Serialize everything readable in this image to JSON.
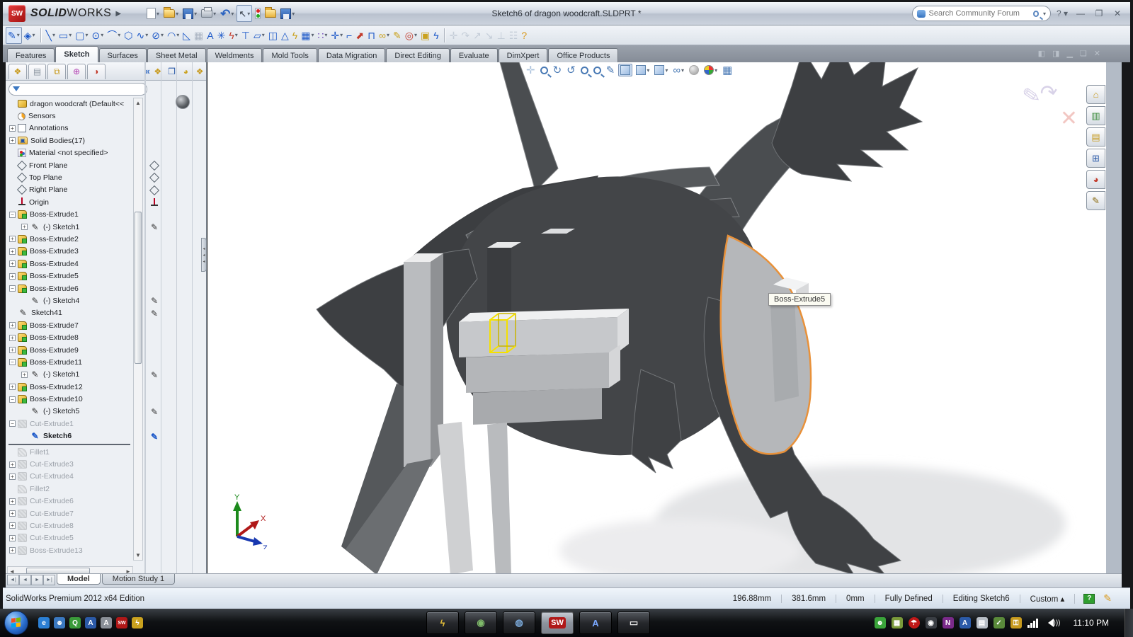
{
  "window": {
    "brand_solid": "SOLID",
    "brand_works": "WORKS",
    "title": "Sketch6 of dragon woodcraft.SLDPRT *",
    "search_placeholder": "Search Community Forum",
    "help_glyph": "?",
    "minimize_glyph": "—",
    "restore_glyph": "❐",
    "close_glyph": "✕"
  },
  "standard_toolbar": [
    {
      "name": "new-document-icon",
      "kind": "page",
      "dd": true
    },
    {
      "name": "open-icon",
      "kind": "folder",
      "dd": true
    },
    {
      "name": "save-icon",
      "kind": "save",
      "dd": true
    },
    {
      "name": "print-icon",
      "kind": "print",
      "dd": true
    },
    {
      "name": "undo-icon",
      "kind": "undo",
      "glyph": "↶",
      "dd": true
    },
    {
      "name": "select-icon",
      "kind": "cursor",
      "glyph": "↖",
      "dd": true,
      "pressed": true
    },
    {
      "name": "rebuild-traffic-icon",
      "kind": "traffic",
      "dd": false
    },
    {
      "name": "options-icon",
      "kind": "folder",
      "dd": false
    },
    {
      "name": "design-checker-icon",
      "kind": "save",
      "dd": true
    }
  ],
  "sketch_toolbar": [
    {
      "name": "sketch-tool-icon",
      "glyph": "✎",
      "color": "#1a57c8",
      "pressed": true,
      "dd": true
    },
    {
      "name": "smart-dimension-icon",
      "glyph": "◈",
      "color": "#1a57c8",
      "dd": true
    },
    {
      "name": "separator",
      "sep": true
    },
    {
      "name": "line-icon",
      "glyph": "╲",
      "color": "#1a57c8",
      "dd": true
    },
    {
      "name": "corner-rectangle-icon",
      "glyph": "▭",
      "color": "#1a57c8",
      "dd": true
    },
    {
      "name": "straight-slot-icon",
      "glyph": "▢",
      "color": "#1a57c8",
      "dd": true
    },
    {
      "name": "circle-icon",
      "glyph": "⊙",
      "color": "#1a57c8",
      "dd": true
    },
    {
      "name": "centerpoint-arc-icon",
      "glyph": "⌒",
      "color": "#1a57c8",
      "dd": true
    },
    {
      "name": "polygon-icon",
      "glyph": "⬡",
      "color": "#1a57c8",
      "dd": false
    },
    {
      "name": "spline-icon",
      "glyph": "∿",
      "color": "#1a57c8",
      "dd": true
    },
    {
      "name": "ellipse-icon",
      "glyph": "⊘",
      "color": "#1a57c8",
      "dd": true
    },
    {
      "name": "sketch-fillet-icon",
      "glyph": "◠",
      "color": "#1a57c8",
      "dd": true
    },
    {
      "name": "chamfer-icon",
      "glyph": "◺",
      "color": "#1a57c8",
      "dd": false
    },
    {
      "name": "mirror-box-icon",
      "glyph": "▦",
      "color": "#aab4c2",
      "dd": false
    },
    {
      "name": "text-icon",
      "glyph": "A",
      "color": "#1a57c8",
      "dd": false
    },
    {
      "name": "point-icon",
      "glyph": "✳",
      "color": "#1a57c8",
      "dd": false
    },
    {
      "name": "trim-entities-icon",
      "glyph": "ϟ",
      "color": "#c23a2a",
      "dd": true
    },
    {
      "name": "convert-entities-icon",
      "glyph": "⊤",
      "color": "#1a57c8",
      "dd": false
    },
    {
      "name": "offset-entities-icon",
      "glyph": "▱",
      "color": "#1a57c8",
      "dd": true
    },
    {
      "name": "mirror-entities-icon",
      "glyph": "◫",
      "color": "#1a57c8",
      "dd": false
    },
    {
      "name": "dynamic-mirror-icon",
      "glyph": "△",
      "color": "#1a57c8",
      "dd": false
    },
    {
      "name": "sketch-numeric-icon",
      "glyph": "ϟ",
      "color": "#caa21e",
      "dd": false
    },
    {
      "name": "linear-pattern-icon",
      "glyph": "▦",
      "color": "#1a57c8",
      "dd": true
    },
    {
      "name": "circular-pattern-icon",
      "glyph": "∷",
      "color": "#6a3fb5",
      "dd": true
    },
    {
      "name": "move-entities-icon",
      "glyph": "✛",
      "color": "#1a57c8",
      "dd": true
    },
    {
      "name": "make-block-icon",
      "glyph": "⌐",
      "color": "#1a57c8",
      "dd": false
    },
    {
      "name": "modify-sketch-icon",
      "glyph": "⬈",
      "color": "#c23a2a",
      "dd": false
    },
    {
      "name": "step-icon",
      "glyph": "⊓",
      "color": "#1a57c8",
      "dd": false
    },
    {
      "name": "display-relations-icon",
      "glyph": "∞",
      "color": "#caa21e",
      "dd": true
    },
    {
      "name": "add-relation-icon",
      "glyph": "✎",
      "color": "#caa21e",
      "dd": false
    },
    {
      "name": "quick-snaps-icon",
      "glyph": "◎",
      "color": "#c23a2a",
      "dd": true
    },
    {
      "name": "sketch-picture-icon",
      "glyph": "▣",
      "color": "#caa21e",
      "dd": false
    },
    {
      "name": "instant2d-icon",
      "glyph": "ϟ",
      "color": "#1a57c8",
      "dd": false
    },
    {
      "name": "separator",
      "sep": true
    },
    {
      "name": "snap-point-icon",
      "glyph": "✛",
      "color": "#9aa8ba",
      "faded": true,
      "dd": false
    },
    {
      "name": "snap-arc-icon",
      "glyph": "↷",
      "color": "#9aa8ba",
      "faded": true,
      "dd": false
    },
    {
      "name": "snap-line-icon",
      "glyph": "↗",
      "color": "#9aa8ba",
      "faded": true,
      "dd": false
    },
    {
      "name": "snap-diag-icon",
      "glyph": "↘",
      "color": "#9aa8ba",
      "faded": true,
      "dd": false
    },
    {
      "name": "snap-perp-icon",
      "glyph": "⊥",
      "color": "#9aa8ba",
      "faded": true,
      "dd": false
    },
    {
      "name": "snap-grid-icon",
      "glyph": "☷",
      "color": "#9aa8ba",
      "faded": true,
      "dd": false
    },
    {
      "name": "snap-help-icon",
      "glyph": "?",
      "color": "#d99a1e",
      "faded": false,
      "dd": false
    }
  ],
  "cmd_tabs": [
    {
      "label": "Features",
      "active": false
    },
    {
      "label": "Sketch",
      "active": true
    },
    {
      "label": "Surfaces",
      "active": false
    },
    {
      "label": "Sheet Metal",
      "active": false
    },
    {
      "label": "Weldments",
      "active": false
    },
    {
      "label": "Mold Tools",
      "active": false
    },
    {
      "label": "Data Migration",
      "active": false
    },
    {
      "label": "Direct Editing",
      "active": false
    },
    {
      "label": "Evaluate",
      "active": false
    },
    {
      "label": "DimXpert",
      "active": false
    },
    {
      "label": "Office Products",
      "active": false
    }
  ],
  "doc_controls": [
    "◧",
    "◨",
    "▁",
    "❏",
    "✕"
  ],
  "feature_manager": {
    "tabs": [
      "feature-tree-tab",
      "property-tab",
      "configuration-tab",
      "dimxpert-tab",
      "display-manager-tab"
    ],
    "tab_glyphs": [
      "❖",
      "▤",
      "⧉",
      "⊕",
      "◑"
    ],
    "tab_colors": [
      "#c79a1e",
      "#8a94a0",
      "#c79a1e",
      "#b03ab0",
      "#c23a2a"
    ],
    "collapse_glyph": "«",
    "flyout_glyphs": [
      "❖",
      "❒",
      "◕",
      "❖"
    ],
    "flyout_colors": [
      "#c79a1e",
      "#2b5aa8",
      "#caa21e",
      "#c79a1e"
    ],
    "tree": [
      {
        "label": "dragon woodcraft  (Default<<",
        "icon": "part",
        "indent": 0,
        "expand": "none",
        "grey": false,
        "bold": false,
        "right": "none"
      },
      {
        "label": "Sensors",
        "icon": "sensor",
        "indent": 0,
        "expand": "none",
        "grey": false,
        "right": "none"
      },
      {
        "label": "Annotations",
        "icon": "ann",
        "indent": 0,
        "expand": "plus",
        "grey": false,
        "right": "none"
      },
      {
        "label": "Solid Bodies(17)",
        "icon": "bodies",
        "indent": 0,
        "expand": "plus",
        "grey": false,
        "right": "none"
      },
      {
        "label": "Material <not specified>",
        "icon": "mat",
        "indent": 0,
        "expand": "none",
        "grey": false,
        "right": "none"
      },
      {
        "label": "Front Plane",
        "icon": "plane",
        "indent": 0,
        "expand": "none",
        "grey": false,
        "right": "plane"
      },
      {
        "label": "Top Plane",
        "icon": "plane",
        "indent": 0,
        "expand": "none",
        "grey": false,
        "right": "plane"
      },
      {
        "label": "Right Plane",
        "icon": "plane",
        "indent": 0,
        "expand": "none",
        "grey": false,
        "right": "plane"
      },
      {
        "label": "Origin",
        "icon": "origin",
        "indent": 0,
        "expand": "none",
        "grey": false,
        "right": "origin"
      },
      {
        "label": "Boss-Extrude1",
        "icon": "boss",
        "indent": 0,
        "expand": "minus",
        "grey": false,
        "right": "none"
      },
      {
        "label": "(-) Sketch1",
        "icon": "sketch",
        "indent": 1,
        "expand": "plus",
        "grey": false,
        "right": "pencil"
      },
      {
        "label": "Boss-Extrude2",
        "icon": "boss",
        "indent": 0,
        "expand": "plus",
        "grey": false,
        "right": "none"
      },
      {
        "label": "Boss-Extrude3",
        "icon": "boss",
        "indent": 0,
        "expand": "plus",
        "grey": false,
        "right": "none"
      },
      {
        "label": "Boss-Extrude4",
        "icon": "boss",
        "indent": 0,
        "expand": "plus",
        "grey": false,
        "right": "none"
      },
      {
        "label": "Boss-Extrude5",
        "icon": "boss",
        "indent": 0,
        "expand": "plus",
        "grey": false,
        "right": "none"
      },
      {
        "label": "Boss-Extrude6",
        "icon": "boss",
        "indent": 0,
        "expand": "minus",
        "grey": false,
        "right": "none"
      },
      {
        "label": "(-) Sketch4",
        "icon": "sketch",
        "indent": 1,
        "expand": "none",
        "grey": false,
        "right": "pencil"
      },
      {
        "label": "Sketch41",
        "icon": "sketch",
        "indent": 0,
        "expand": "none",
        "grey": false,
        "right": "pencil"
      },
      {
        "label": "Boss-Extrude7",
        "icon": "boss",
        "indent": 0,
        "expand": "plus",
        "grey": false,
        "right": "none"
      },
      {
        "label": "Boss-Extrude8",
        "icon": "boss",
        "indent": 0,
        "expand": "plus",
        "grey": false,
        "right": "none"
      },
      {
        "label": "Boss-Extrude9",
        "icon": "boss",
        "indent": 0,
        "expand": "plus",
        "grey": false,
        "right": "none"
      },
      {
        "label": "Boss-Extrude11",
        "icon": "boss",
        "indent": 0,
        "expand": "minus",
        "grey": false,
        "right": "none"
      },
      {
        "label": "(-) Sketch1",
        "icon": "sketch",
        "indent": 1,
        "expand": "plus",
        "grey": false,
        "right": "pencil"
      },
      {
        "label": "Boss-Extrude12",
        "icon": "boss",
        "indent": 0,
        "expand": "plus",
        "grey": false,
        "right": "none"
      },
      {
        "label": "Boss-Extrude10",
        "icon": "boss",
        "indent": 0,
        "expand": "minus",
        "grey": false,
        "right": "none"
      },
      {
        "label": "(-) Sketch5",
        "icon": "sketch",
        "indent": 1,
        "expand": "none",
        "grey": false,
        "right": "pencil"
      },
      {
        "label": "Cut-Extrude1",
        "icon": "cut",
        "indent": 0,
        "expand": "minus",
        "grey": true,
        "right": "none"
      },
      {
        "label": "Sketch6",
        "icon": "sketch-b",
        "indent": 1,
        "expand": "none",
        "grey": false,
        "bold": true,
        "right": "pencil-b"
      },
      {
        "label": "ROLLBACK",
        "rollback": true
      },
      {
        "label": "Fillet1",
        "icon": "fillet",
        "indent": 0,
        "expand": "none",
        "grey": true,
        "right": "none"
      },
      {
        "label": "Cut-Extrude3",
        "icon": "cut",
        "indent": 0,
        "expand": "plus",
        "grey": true,
        "right": "none"
      },
      {
        "label": "Cut-Extrude4",
        "icon": "cut",
        "indent": 0,
        "expand": "plus",
        "grey": true,
        "right": "none"
      },
      {
        "label": "Fillet2",
        "icon": "fillet",
        "indent": 0,
        "expand": "none",
        "grey": true,
        "right": "none"
      },
      {
        "label": "Cut-Extrude6",
        "icon": "cut",
        "indent": 0,
        "expand": "plus",
        "grey": true,
        "right": "none"
      },
      {
        "label": "Cut-Extrude7",
        "icon": "cut",
        "indent": 0,
        "expand": "plus",
        "grey": true,
        "right": "none"
      },
      {
        "label": "Cut-Extrude8",
        "icon": "cut",
        "indent": 0,
        "expand": "plus",
        "grey": true,
        "right": "none"
      },
      {
        "label": "Cut-Extrude5",
        "icon": "cut",
        "indent": 0,
        "expand": "plus",
        "grey": true,
        "right": "none"
      },
      {
        "label": "Boss-Extrude13",
        "icon": "cut",
        "indent": 0,
        "expand": "plus",
        "grey": true,
        "right": "none"
      }
    ]
  },
  "heads_up": [
    {
      "name": "pan-icon",
      "glyph": "✛",
      "faded": true
    },
    {
      "name": "zoom-fit-icon",
      "mag": true
    },
    {
      "name": "rotate-view-icon",
      "glyph": "↻"
    },
    {
      "name": "refresh-icon",
      "glyph": "↺"
    },
    {
      "name": "zoom-in-icon",
      "mag": true
    },
    {
      "name": "zoom-area-icon",
      "mag": true
    },
    {
      "name": "fly-icon",
      "glyph": "✎"
    },
    {
      "name": "shaded-edges-icon",
      "cube": true,
      "pressed": true,
      "dd": false
    },
    {
      "name": "section-view-icon",
      "cube": true,
      "dd": true
    },
    {
      "name": "view-orientation-icon",
      "cube": true,
      "dd": true
    },
    {
      "name": "display-style-icon",
      "glyph": "∞",
      "dd": true
    },
    {
      "name": "hide-show-icon",
      "ball": "grey"
    },
    {
      "name": "appearance-icon",
      "ball": "color",
      "dd": true
    },
    {
      "name": "scene-icon",
      "glyph": "▦"
    }
  ],
  "task_pane": [
    {
      "name": "home-tab",
      "glyph": "⌂",
      "color": "#c79a1e"
    },
    {
      "name": "design-library-tab",
      "glyph": "▥",
      "color": "#3a8a3a"
    },
    {
      "name": "file-explorer-tab",
      "glyph": "▤",
      "color": "#c79a1e"
    },
    {
      "name": "view-palette-tab",
      "glyph": "⊞",
      "color": "#2b5aa8"
    },
    {
      "name": "appearances-tab",
      "glyph": "◕",
      "color": "#c23a2a"
    },
    {
      "name": "custom-properties-tab",
      "glyph": "✎",
      "color": "#8a6a10"
    }
  ],
  "viewport": {
    "tooltip": "Boss-Extrude5",
    "triad": {
      "x": "X",
      "y": "Y",
      "z": "Z"
    }
  },
  "bottom_tabs": {
    "nav": [
      "◄|",
      "◄",
      "►",
      "►|"
    ],
    "model": "Model",
    "motion": "Motion Study 1"
  },
  "status_bar": {
    "left": "SolidWorks Premium 2012 x64 Edition",
    "coord_x": "196.88mm",
    "coord_y": "381.6mm",
    "coord_z": "0mm",
    "state": "Fully Defined",
    "editing": "Editing Sketch6",
    "units": "Custom",
    "units_arrow": "▴"
  },
  "taskbar": {
    "quick_launch": [
      {
        "name": "ie-icon",
        "glyph": "e",
        "bg": "#2b7fd4"
      },
      {
        "name": "messenger-icon",
        "glyph": "☻",
        "bg": "#3a78c0"
      },
      {
        "name": "media-icon",
        "glyph": "Q",
        "bg": "#3a9a3a"
      },
      {
        "name": "app-a-blue-icon",
        "glyph": "A",
        "bg": "#2b5aa8"
      },
      {
        "name": "app-a-grey-icon",
        "glyph": "A",
        "bg": "#8a9098"
      },
      {
        "name": "solidworks-icon",
        "glyph": "SW",
        "bg": "#b01818"
      },
      {
        "name": "edrawings-icon",
        "glyph": "ϟ",
        "bg": "#caa21e"
      }
    ],
    "apps": [
      {
        "name": "app-lightning",
        "glyph": "ϟ",
        "color": "#e8c23a",
        "active": false
      },
      {
        "name": "app-globe-hand",
        "glyph": "◉",
        "color": "#7fba6a",
        "active": false
      },
      {
        "name": "app-network-globe",
        "glyph": "◍",
        "color": "#7aa8d8",
        "active": false
      },
      {
        "name": "app-solidworks",
        "glyph": "SW",
        "color": "#e23b3b",
        "active": true
      },
      {
        "name": "app-a-blue",
        "glyph": "A",
        "color": "#7aa8ff",
        "active": false
      },
      {
        "name": "app-notepad",
        "glyph": "▭",
        "color": "#e8e8e8",
        "active": false
      }
    ],
    "tray": [
      {
        "name": "tray-person-icon",
        "glyph": "☻",
        "bg": "#3aa43a"
      },
      {
        "name": "tray-grid-icon",
        "glyph": "▦",
        "bg": "#7a9a3a"
      },
      {
        "name": "tray-avira-icon",
        "glyph": "☂",
        "bg": "#c01818",
        "round": true
      },
      {
        "name": "tray-disc-icon",
        "glyph": "◉",
        "bg": "#3a3e44"
      },
      {
        "name": "tray-onenote-icon",
        "glyph": "N",
        "bg": "#7a2a8a"
      },
      {
        "name": "tray-a-icon",
        "glyph": "A",
        "bg": "#2b5aa8"
      },
      {
        "name": "tray-clipboard-icon",
        "glyph": "▤",
        "bg": "#b8bec6"
      },
      {
        "name": "tray-usb-icon",
        "glyph": "✓",
        "bg": "#5a8a3a"
      },
      {
        "name": "tray-lock-icon",
        "glyph": "⚿",
        "bg": "#c79a1e"
      }
    ],
    "clock": "11:10 PM"
  }
}
